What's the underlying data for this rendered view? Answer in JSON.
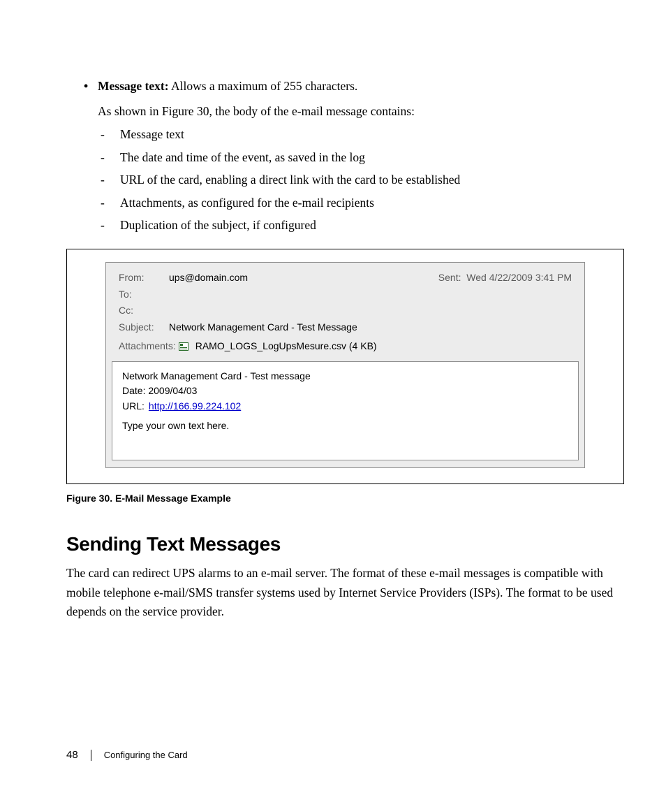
{
  "bullet": {
    "lead": "Message text:",
    "rest": " Allows a maximum of 255 characters."
  },
  "intro": "As shown in Figure 30, the body of the e-mail message contains:",
  "dashes": [
    "Message text",
    "The date and time of the event, as saved in the log",
    "URL of the card, enabling a direct link with the card to be established",
    "Attachments, as configured for the e-mail recipients",
    "Duplication of the subject, if configured"
  ],
  "email": {
    "from_label": "From:",
    "from": "ups@domain.com",
    "sent_label": "Sent:",
    "sent": "Wed 4/22/2009 3:41 PM",
    "to_label": "To:",
    "to": "",
    "cc_label": "Cc:",
    "cc": "",
    "subject_label": "Subject:",
    "subject": "Network Management Card - Test Message",
    "attach_label": "Attachments:",
    "attach_file": "RAMO_LOGS_LogUpsMesure.csv (4 KB)",
    "body_title": "Network Management Card - Test message",
    "body_date": "Date: 2009/04/03",
    "body_url_label": "URL:",
    "body_url": "http://166.99.224.102",
    "body_text": "Type your own text here."
  },
  "figure_caption": "Figure 30. E-Mail Message Example",
  "heading": "Sending Text Messages",
  "para": "The card can redirect UPS alarms to an e-mail server. The format of these e-mail messages is compatible with mobile telephone e-mail/SMS transfer systems used by Internet Service Providers (ISPs). The format to be used depends on the service provider.",
  "footer": {
    "page": "48",
    "section": "Configuring the Card"
  }
}
